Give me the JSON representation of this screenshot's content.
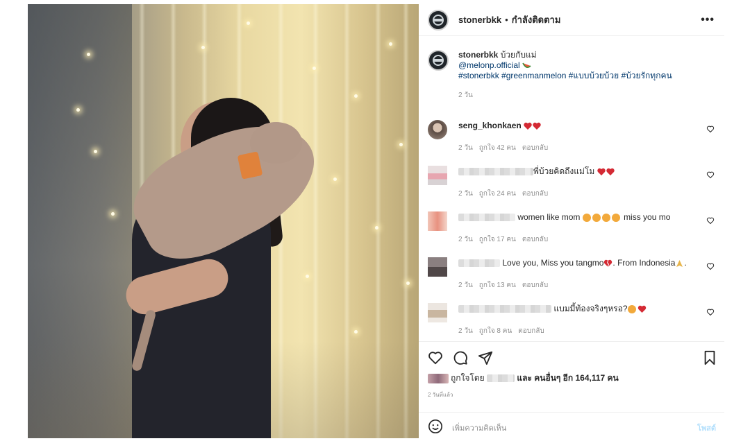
{
  "post": {
    "username": "stonerbkk",
    "separator": "•",
    "follow_status": "กำลังติดตาม",
    "more": "•••"
  },
  "caption": {
    "username": "stonerbkk",
    "text": "บ้วยกับแม่",
    "mention": "@melonp.official",
    "hashtags": "#stonerbkk #greenmanmelon #แบบบ้วยบ้วย #บ้วยรักทุกคน",
    "time": "2 วัน"
  },
  "comments": [
    {
      "username": "seng_khonkaen",
      "text": "",
      "time": "2 วัน",
      "likes": "ถูกใจ 42 คน",
      "reply": "ตอบกลับ"
    },
    {
      "username": "",
      "text": "พี่บ้วยคิดถึงแม่โม",
      "time": "2 วัน",
      "likes": "ถูกใจ 24 คน",
      "reply": "ตอบกลับ"
    },
    {
      "username": "",
      "text": "women like mom",
      "text2": "miss you mo",
      "time": "2 วัน",
      "likes": "ถูกใจ 17 คน",
      "reply": "ตอบกลับ"
    },
    {
      "username": "",
      "text": "Love you, Miss you tangmo",
      "text2": ". From Indonesia",
      "text3": ".",
      "time": "2 วัน",
      "likes": "ถูกใจ 13 คน",
      "reply": "ตอบกลับ"
    },
    {
      "username": "",
      "text": "แบมมี้ท้องจริงๆหรอ?",
      "time": "2 วัน",
      "likes": "ถูกใจ 8 คน",
      "reply": "ตอบกลับ"
    }
  ],
  "likes_line": {
    "prefix": "ถูกใจโดย",
    "and_others": "และ คนอื่นๆ อีก 164,117 คน"
  },
  "posted_ago": "2 วันที่แล้ว",
  "add_comment": {
    "placeholder": "เพิ่มความคิดเห็น",
    "post": "โพสต์"
  },
  "colors": {
    "heart": "#ed4956",
    "link": "#00376b",
    "muted": "#8e8e8e",
    "post_disabled": "#b2dffc"
  },
  "icons": [
    "heart-icon",
    "comment-icon",
    "share-icon",
    "bookmark-icon",
    "smile-icon",
    "more-icon"
  ]
}
